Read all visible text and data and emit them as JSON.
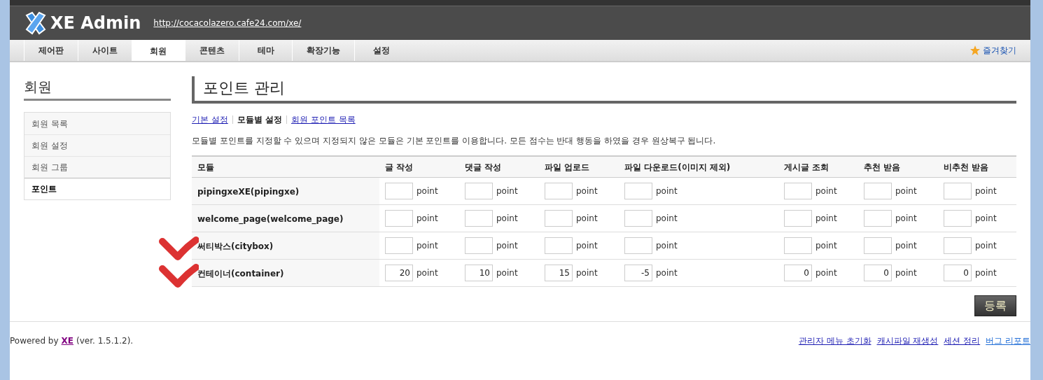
{
  "header": {
    "logo_text": "XE Admin",
    "site_url": "http://cocacolazero.cafe24.com/xe/"
  },
  "nav": {
    "tabs": [
      {
        "label": "제어판",
        "selected": false
      },
      {
        "label": "사이트",
        "selected": false
      },
      {
        "label": "회원",
        "selected": true
      },
      {
        "label": "콘텐츠",
        "selected": false
      },
      {
        "label": "테마",
        "selected": false
      },
      {
        "label": "확장기능",
        "selected": false
      },
      {
        "label": "설정",
        "selected": false
      }
    ],
    "favorites": "즐겨찾기"
  },
  "sidebar": {
    "title": "회원",
    "items": [
      {
        "label": "회원 목록",
        "selected": false
      },
      {
        "label": "회원 설정",
        "selected": false
      },
      {
        "label": "회원 그룹",
        "selected": false
      },
      {
        "label": "포인트",
        "selected": true
      }
    ]
  },
  "main": {
    "title": "포인트 관리",
    "subtabs": [
      {
        "label": "기본 설정",
        "selected": false
      },
      {
        "label": "모듈별 설정",
        "selected": true
      },
      {
        "label": "회원 포인트 목록",
        "selected": false
      }
    ],
    "description": "모듈별 포인트를 지정할 수 있으며 지정되지 않은 모듈은 기본 포인트를 이용합니다. 모든 점수는 반대 행동을 하였을 경우 원상복구 됩니다.",
    "table": {
      "module_column": "모듈",
      "columns": [
        "글 작성",
        "댓글 작성",
        "파일 업로드",
        "파일 다운로드(이미지 제외)",
        "게시글 조회",
        "추천 받음",
        "비추천 받음"
      ],
      "rows": [
        {
          "module": "pipingxeXE(pipingxe)",
          "marked": false,
          "cells": [
            {
              "unit": "point"
            },
            {
              "unit": "point"
            },
            {
              "unit": "point"
            },
            {
              "unit": "point"
            },
            {
              "unit": "point"
            },
            {
              "unit": "point"
            },
            {
              "unit": "point"
            }
          ]
        },
        {
          "module": "welcome_page(welcome_page)",
          "marked": false,
          "cells": [
            {
              "unit": "point"
            },
            {
              "unit": "point"
            },
            {
              "unit": "point"
            },
            {
              "unit": "point"
            },
            {
              "unit": "point"
            },
            {
              "unit": "point"
            },
            {
              "unit": "point"
            }
          ]
        },
        {
          "module": "써티박스(citybox)",
          "marked": true,
          "cells": [
            {
              "unit": "point"
            },
            {
              "unit": "point"
            },
            {
              "unit": "point"
            },
            {
              "unit": "point"
            },
            {
              "unit": "point"
            },
            {
              "unit": "point"
            },
            {
              "unit": "point"
            }
          ]
        },
        {
          "module": "컨테이너(container)",
          "marked": true,
          "cells": [
            {
              "value": "20",
              "unit": "point"
            },
            {
              "value": "10",
              "unit": "point"
            },
            {
              "value": "15",
              "unit": "point"
            },
            {
              "value": "-5",
              "unit": "point"
            },
            {
              "value": "0",
              "unit": "point"
            },
            {
              "value": "0",
              "unit": "point"
            },
            {
              "value": "0",
              "unit": "point"
            }
          ]
        }
      ]
    },
    "submit_button": "등록"
  },
  "footer": {
    "powered_prefix": "Powered by",
    "powered_link": "XE",
    "powered_suffix": "(ver. 1.5.1.2).",
    "links": [
      "관리자 메뉴 초기화",
      "캐시파일 재생성",
      "세션 정리",
      "버그 리포트"
    ]
  }
}
